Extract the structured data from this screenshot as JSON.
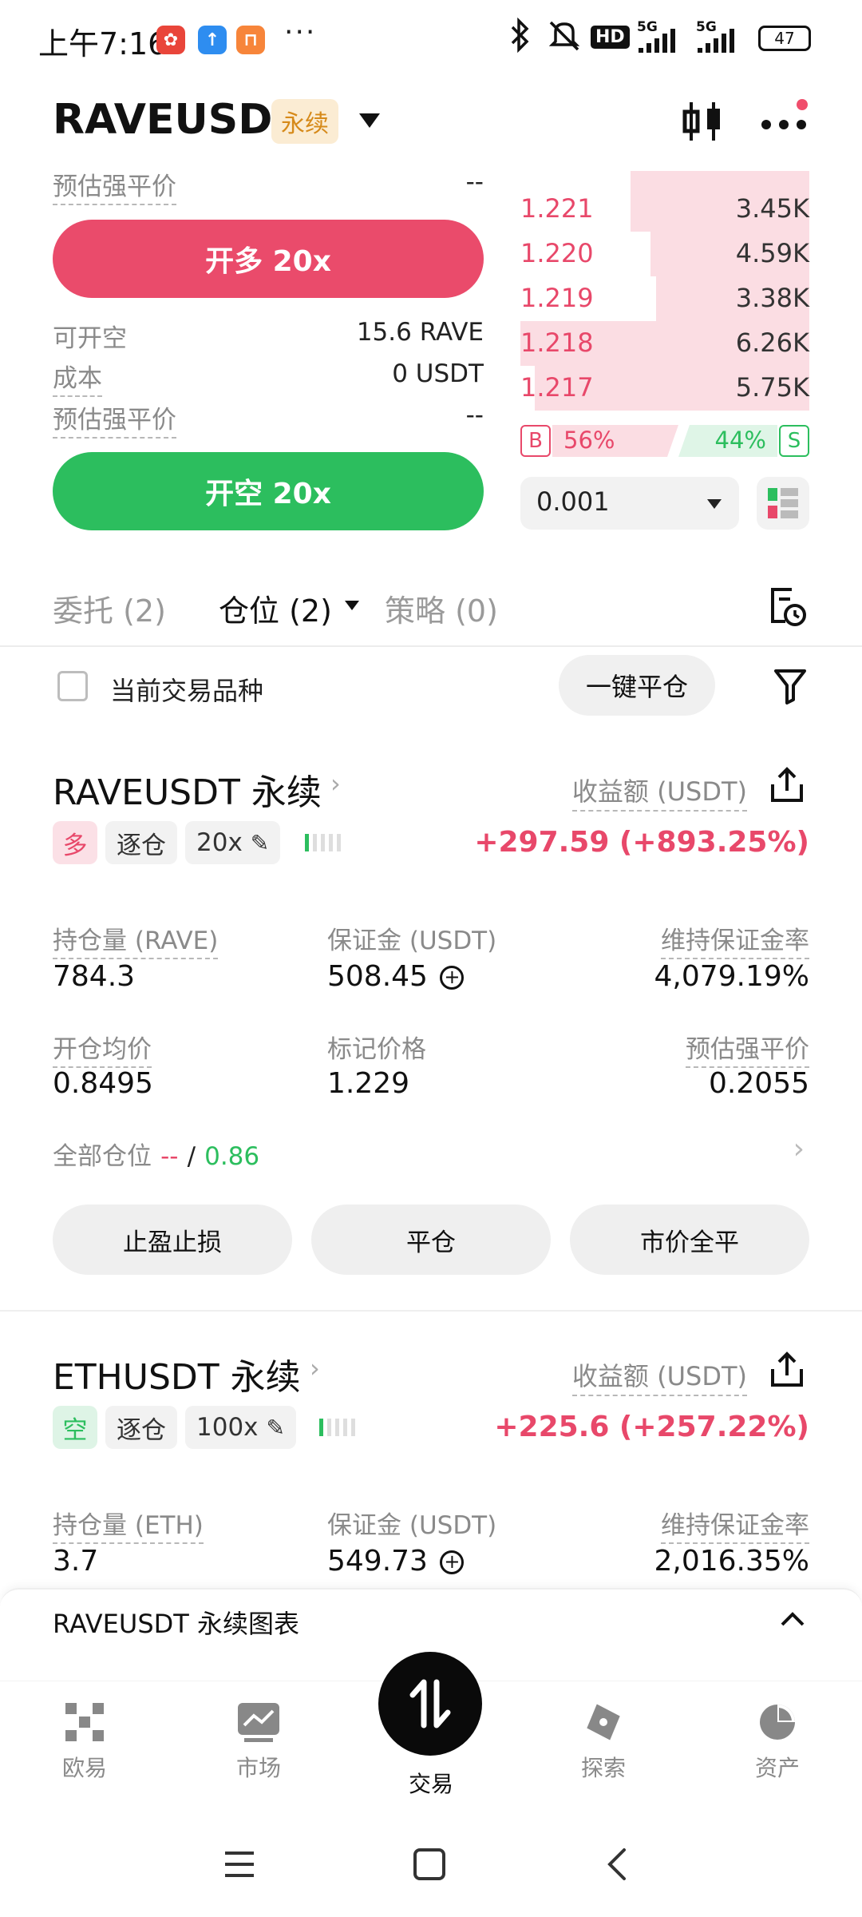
{
  "status_bar": {
    "time": "上午7:16",
    "more": "···",
    "hd": "HD",
    "net1": "5G",
    "net2": "5G",
    "battery": "47"
  },
  "header": {
    "pair": "RAVEUSDT",
    "type_tag": "永续"
  },
  "order_form": {
    "liq_label_top": "预估强平价",
    "liq_value_top": "--",
    "long_button": "开多 20x",
    "avail_short_label": "可开空",
    "avail_short_value": "15.6 RAVE",
    "cost_label": "成本",
    "cost_value": "0 USDT",
    "liq_label": "预估强平价",
    "liq_value": "--",
    "short_button": "开空 20x"
  },
  "order_book": {
    "asks": [
      {
        "price": "1.221",
        "qty": "3.45K",
        "depth": 0.62
      },
      {
        "price": "1.220",
        "qty": "4.59K",
        "depth": 0.55
      },
      {
        "price": "1.219",
        "qty": "3.38K",
        "depth": 0.53
      },
      {
        "price": "1.218",
        "qty": "6.26K",
        "depth": 1.0
      },
      {
        "price": "1.217",
        "qty": "5.75K",
        "depth": 0.95
      }
    ],
    "buy_label": "B",
    "buy_pct": "56%",
    "sell_label": "S",
    "sell_pct": "44%",
    "buy_ratio": 0.56,
    "precision": "0.001"
  },
  "tabs": {
    "orders": "委托 (2)",
    "positions": "仓位 (2)",
    "strategies": "策略 (0)"
  },
  "filter": {
    "current_symbol_label": "当前交易品种",
    "close_all_button": "一键平仓"
  },
  "positions": [
    {
      "title": "RAVEUSDT 永续",
      "pnl_label": "收益额 (USDT)",
      "side": "多",
      "margin_mode": "逐仓",
      "leverage": "20x",
      "pnl": "+297.59 (+893.25%)",
      "size_label": "持仓量 (RAVE)",
      "size": "784.3",
      "margin_label": "保证金 (USDT)",
      "margin": "508.45",
      "mmr_label": "维持保证金率",
      "mmr": "4,079.19%",
      "entry_label": "开仓均价",
      "entry": "0.8495",
      "mark_label": "标记价格",
      "mark": "1.229",
      "liq_label": "预估强平价",
      "liq": "0.2055",
      "all_pos_label": "全部仓位",
      "all_pos_a": "--",
      "all_pos_sep": "/",
      "all_pos_b": "0.86",
      "btn_tpsl": "止盈止损",
      "btn_close": "平仓",
      "btn_market_close": "市价全平"
    },
    {
      "title": "ETHUSDT 永续",
      "pnl_label": "收益额 (USDT)",
      "side": "空",
      "margin_mode": "逐仓",
      "leverage": "100x",
      "pnl": "+225.6 (+257.22%)",
      "size_label": "持仓量 (ETH)",
      "size": "3.7",
      "margin_label": "保证金 (USDT)",
      "margin": "549.73",
      "mmr_label": "维持保证金率",
      "mmr": "2,016.35%"
    }
  ],
  "chart_drawer": {
    "label": "RAVEUSDT 永续图表"
  },
  "bottom_nav": [
    {
      "label": "欧易",
      "icon": "okx-logo-icon"
    },
    {
      "label": "市场",
      "icon": "market-chart-icon"
    },
    {
      "label": "交易",
      "icon": "trade-swap-icon"
    },
    {
      "label": "探索",
      "icon": "explore-compass-icon"
    },
    {
      "label": "资产",
      "icon": "assets-pie-icon"
    }
  ],
  "colors": {
    "red": "#e8486a",
    "green": "#2cbe5e",
    "tag_bg": "#fbecd3",
    "tag_text": "#d68a1a"
  }
}
